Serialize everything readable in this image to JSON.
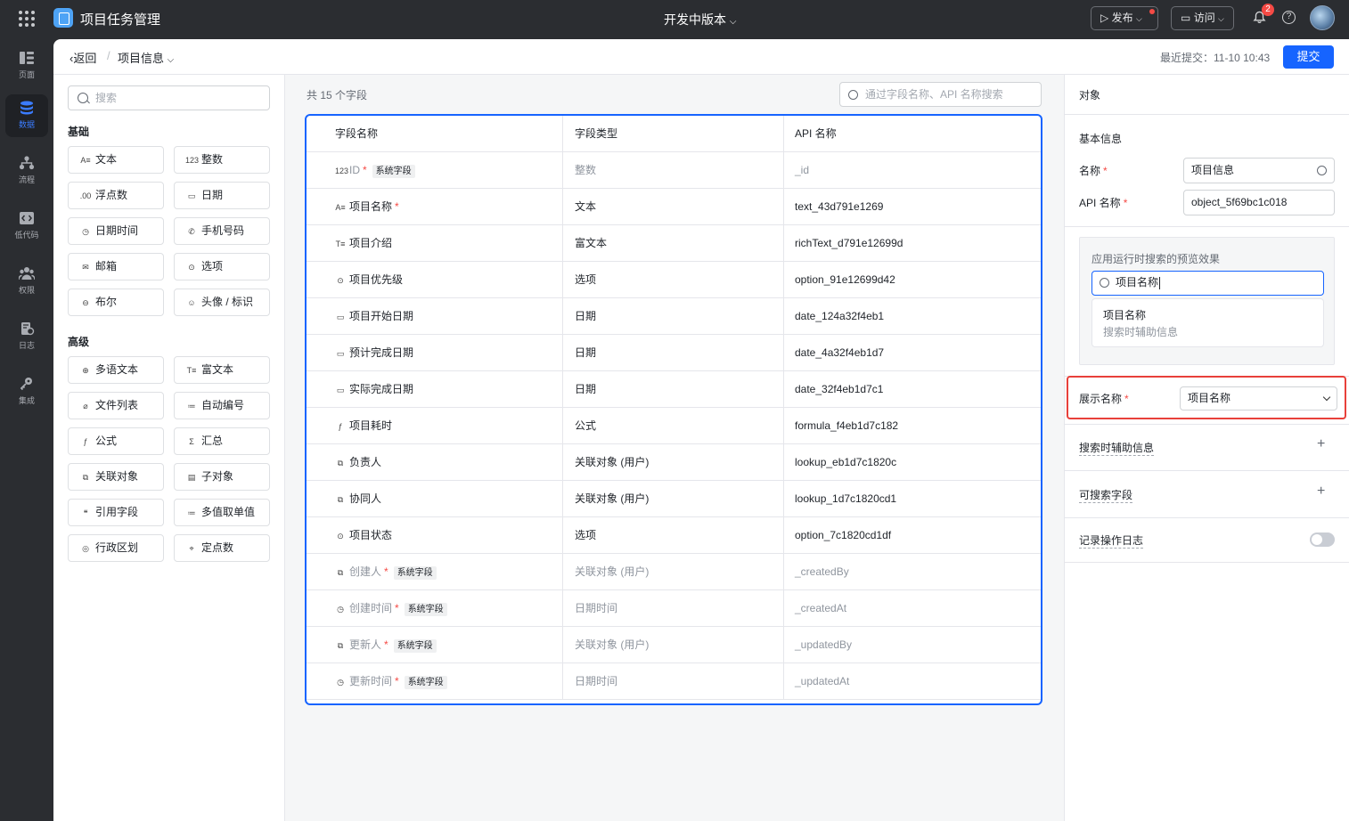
{
  "app": {
    "title": "项目任务管理",
    "version": "开发中版本"
  },
  "topbar": {
    "publish": "发布",
    "visit": "访问",
    "notification_count": "2",
    "help": "?"
  },
  "leftnav": [
    {
      "label": "页面",
      "icon": "page-icon"
    },
    {
      "label": "数据",
      "icon": "database-icon",
      "active": true
    },
    {
      "label": "流程",
      "icon": "flow-icon"
    },
    {
      "label": "低代码",
      "icon": "code-icon"
    },
    {
      "label": "权限",
      "icon": "users-icon"
    },
    {
      "label": "日志",
      "icon": "log-icon"
    },
    {
      "label": "集成",
      "icon": "key-icon"
    }
  ],
  "header": {
    "back": "返回",
    "sep": "/",
    "breadcrumb": "项目信息",
    "recent": "最近提交：11-10 10:43",
    "submit": "提交"
  },
  "field_panel": {
    "search_placeholder": "搜索",
    "basic_title": "基础",
    "basic": [
      {
        "icon": "A≡",
        "label": "文本"
      },
      {
        "icon": "123",
        "label": "整数"
      },
      {
        "icon": ".00",
        "label": "浮点数"
      },
      {
        "icon": "▭",
        "label": "日期"
      },
      {
        "icon": "◷",
        "label": "日期时间"
      },
      {
        "icon": "✆",
        "label": "手机号码"
      },
      {
        "icon": "✉",
        "label": "邮箱"
      },
      {
        "icon": "⊙",
        "label": "选项"
      },
      {
        "icon": "⊖",
        "label": "布尔"
      },
      {
        "icon": "☺",
        "label": "头像 / 标识"
      }
    ],
    "advanced_title": "高级",
    "advanced": [
      {
        "icon": "⊕",
        "label": "多语文本"
      },
      {
        "icon": "T≡",
        "label": "富文本"
      },
      {
        "icon": "⌀",
        "label": "文件列表"
      },
      {
        "icon": "≔",
        "label": "自动编号"
      },
      {
        "icon": "ƒ",
        "label": "公式"
      },
      {
        "icon": "Σ",
        "label": "汇总"
      },
      {
        "icon": "⧉",
        "label": "关联对象"
      },
      {
        "icon": "▤",
        "label": "子对象"
      },
      {
        "icon": "❝",
        "label": "引用字段"
      },
      {
        "icon": "≔",
        "label": "多值取单值"
      },
      {
        "icon": "◎",
        "label": "行政区划"
      },
      {
        "icon": "⌖",
        "label": "定点数"
      }
    ]
  },
  "table": {
    "count": "共 15 个字段",
    "search_placeholder": "通过字段名称、API 名称搜索",
    "headers": [
      "字段名称",
      "字段类型",
      "API 名称"
    ],
    "rows": [
      {
        "icon": "123",
        "name": "ID",
        "required": "*",
        "tag": "系统字段",
        "type": "整数",
        "api": "_id",
        "system": true
      },
      {
        "icon": "A≡",
        "name": "项目名称",
        "required": "*",
        "tag": "",
        "type": "文本",
        "api": "text_43d791e1269",
        "system": false
      },
      {
        "icon": "T≡",
        "name": "项目介绍",
        "required": "",
        "tag": "",
        "type": "富文本",
        "api": "richText_d791e12699d",
        "system": false
      },
      {
        "icon": "⊙",
        "name": "项目优先级",
        "required": "",
        "tag": "",
        "type": "选项",
        "api": "option_91e12699d42",
        "system": false
      },
      {
        "icon": "▭",
        "name": "项目开始日期",
        "required": "",
        "tag": "",
        "type": "日期",
        "api": "date_124a32f4eb1",
        "system": false
      },
      {
        "icon": "▭",
        "name": "预计完成日期",
        "required": "",
        "tag": "",
        "type": "日期",
        "api": "date_4a32f4eb1d7",
        "system": false
      },
      {
        "icon": "▭",
        "name": "实际完成日期",
        "required": "",
        "tag": "",
        "type": "日期",
        "api": "date_32f4eb1d7c1",
        "system": false
      },
      {
        "icon": "ƒ",
        "name": "项目耗时",
        "required": "",
        "tag": "",
        "type": "公式",
        "api": "formula_f4eb1d7c182",
        "system": false
      },
      {
        "icon": "⧉",
        "name": "负责人",
        "required": "",
        "tag": "",
        "type": "关联对象 (用户)",
        "api": "lookup_eb1d7c1820c",
        "system": false
      },
      {
        "icon": "⧉",
        "name": "协同人",
        "required": "",
        "tag": "",
        "type": "关联对象 (用户)",
        "api": "lookup_1d7c1820cd1",
        "system": false
      },
      {
        "icon": "⊙",
        "name": "项目状态",
        "required": "",
        "tag": "",
        "type": "选项",
        "api": "option_7c1820cd1df",
        "system": false
      },
      {
        "icon": "⧉",
        "name": "创建人",
        "required": "*",
        "tag": "系统字段",
        "type": "关联对象 (用户)",
        "api": "_createdBy",
        "system": true
      },
      {
        "icon": "◷",
        "name": "创建时间",
        "required": "*",
        "tag": "系统字段",
        "type": "日期时间",
        "api": "_createdAt",
        "system": true
      },
      {
        "icon": "⧉",
        "name": "更新人",
        "required": "*",
        "tag": "系统字段",
        "type": "关联对象 (用户)",
        "api": "_updatedBy",
        "system": true
      },
      {
        "icon": "◷",
        "name": "更新时间",
        "required": "*",
        "tag": "系统字段",
        "type": "日期时间",
        "api": "_updatedAt",
        "system": true
      }
    ]
  },
  "right": {
    "title": "对象",
    "basic_info": "基本信息",
    "name_label": "名称",
    "name_value": "项目信息",
    "api_label": "API 名称",
    "api_value": "object_5f69bc1c018",
    "required": "*",
    "preview_label": "应用运行时搜索的预览效果",
    "preview_input": "项目名称",
    "preview_item": "项目名称",
    "preview_sub": "搜索时辅助信息",
    "display_label": "展示名称",
    "display_value": "项目名称",
    "search_aux": "搜索时辅助信息",
    "searchable": "可搜索字段",
    "log": "记录操作日志",
    "plus": "+"
  }
}
